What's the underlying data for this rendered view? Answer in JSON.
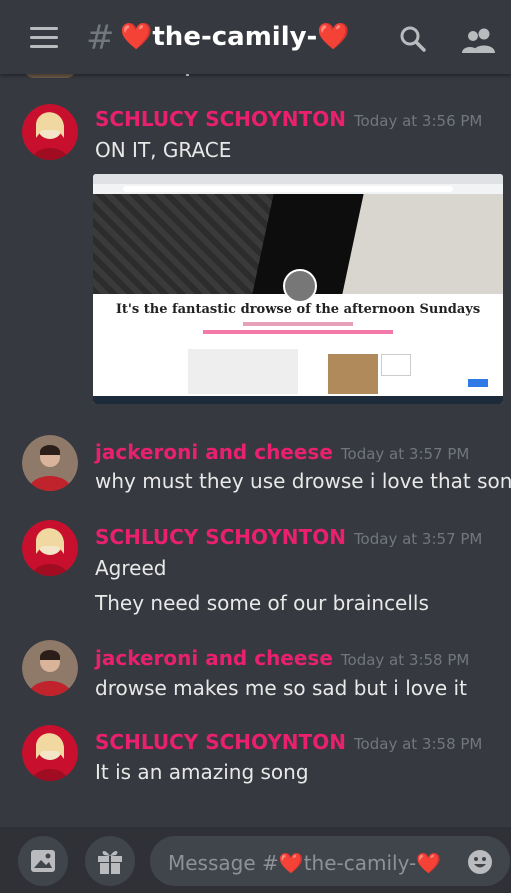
{
  "header": {
    "hash": "#",
    "channel_heart_left": "❤️",
    "channel_name": "the-camily-",
    "channel_heart_right": "❤️"
  },
  "messages": [
    {
      "author": "SCHLUCY SCHOYNTON",
      "timestamp": "Today at 3:56 PM",
      "lines": [
        "ON IT, GRACE"
      ],
      "attachment": {
        "title": "It's the fantastic drowse of the afternoon Sundays"
      }
    },
    {
      "author": "jackeroni and cheese",
      "timestamp": "Today at 3:57 PM",
      "lines": [
        "why must they use drowse i love that song"
      ]
    },
    {
      "author": "SCHLUCY SCHOYNTON",
      "timestamp": "Today at 3:57 PM",
      "lines": [
        "Agreed",
        "They need some of our braincells"
      ]
    },
    {
      "author": "jackeroni and cheese",
      "timestamp": "Today at 3:58 PM",
      "lines": [
        "drowse makes me so sad but i love it"
      ]
    },
    {
      "author": "SCHLUCY SCHOYNTON",
      "timestamp": "Today at 3:58 PM",
      "lines": [
        "It is an amazing song"
      ]
    }
  ],
  "composer": {
    "placeholder_prefix": "Message #",
    "heart_left": "❤️",
    "channel": "the-camily-",
    "heart_right": "❤️"
  },
  "colors": {
    "background": "#36393f",
    "author": "#e9206f",
    "timestamp": "#72767d",
    "composer": "#2f3136"
  },
  "icons": [
    "menu-icon",
    "hash-icon",
    "search-icon",
    "members-icon",
    "image-icon",
    "gift-icon",
    "emoji-icon"
  ]
}
